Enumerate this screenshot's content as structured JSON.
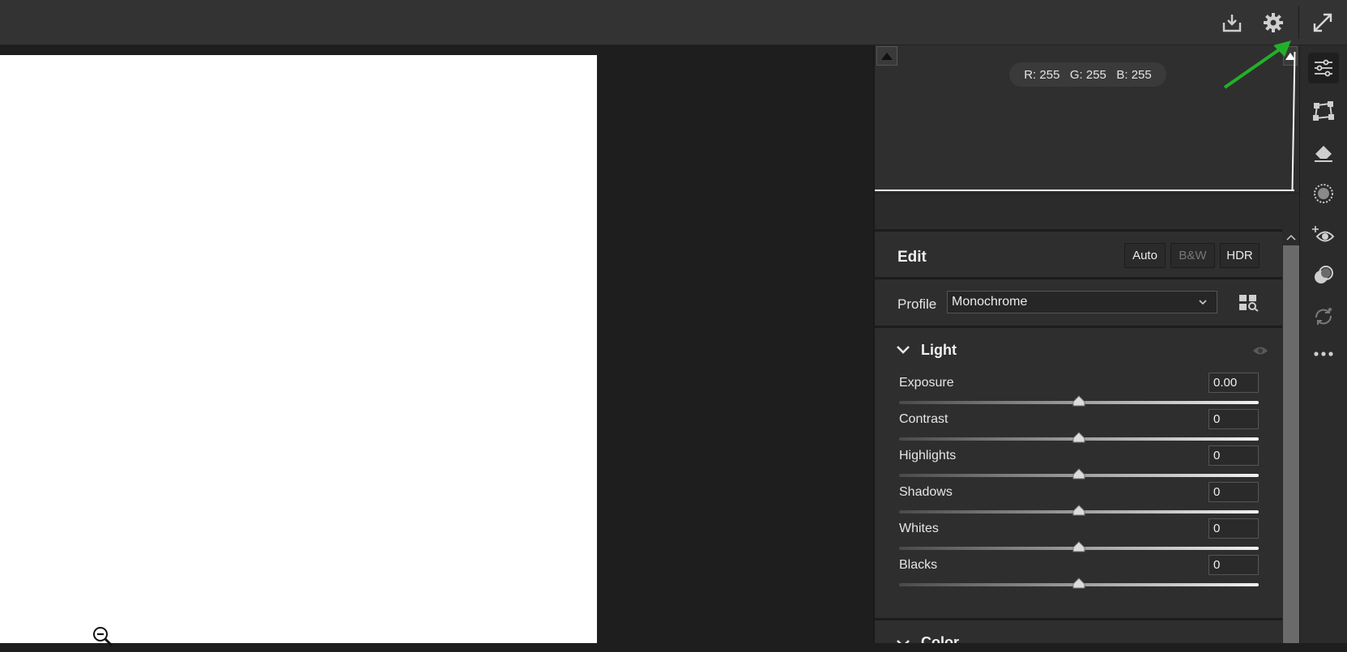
{
  "topbar": {
    "icons": [
      "export-icon",
      "settings-gear-icon",
      "fullscreen-expand-icon"
    ]
  },
  "canvas": {
    "zoom_cursor": "zoom-out-icon"
  },
  "histogram": {
    "rgb": {
      "r": "R: 255",
      "g": "G: 255",
      "b": "B: 255"
    },
    "clip_icons": [
      "shadow-clipping-icon",
      "highlight-clipping-icon"
    ]
  },
  "edit": {
    "title": "Edit",
    "buttons": {
      "auto": "Auto",
      "bw": "B&W",
      "hdr": "HDR"
    },
    "profile_label": "Profile",
    "profile_value": "Monochrome"
  },
  "light": {
    "title": "Light",
    "sliders": [
      {
        "label": "Exposure",
        "value": "0.00",
        "level": 0.5
      },
      {
        "label": "Contrast",
        "value": "0",
        "level": 0.5
      },
      {
        "label": "Highlights",
        "value": "0",
        "level": 0.5
      },
      {
        "label": "Shadows",
        "value": "0",
        "level": 0.5
      },
      {
        "label": "Whites",
        "value": "0",
        "level": 0.5
      },
      {
        "label": "Blacks",
        "value": "0",
        "level": 0.5
      }
    ]
  },
  "color": {
    "title": "Color"
  },
  "tools": [
    "edit-sliders-icon",
    "geometry-crop-icon",
    "eraser-heal-icon",
    "mask-icon",
    "redeye-icon",
    "presets-icon",
    "snapshots-icon",
    "more-icon"
  ],
  "colors": {
    "annotation_arrow": "#22b02a",
    "panel_bg": "#2e2e2e",
    "topbar_bg": "#333333"
  }
}
